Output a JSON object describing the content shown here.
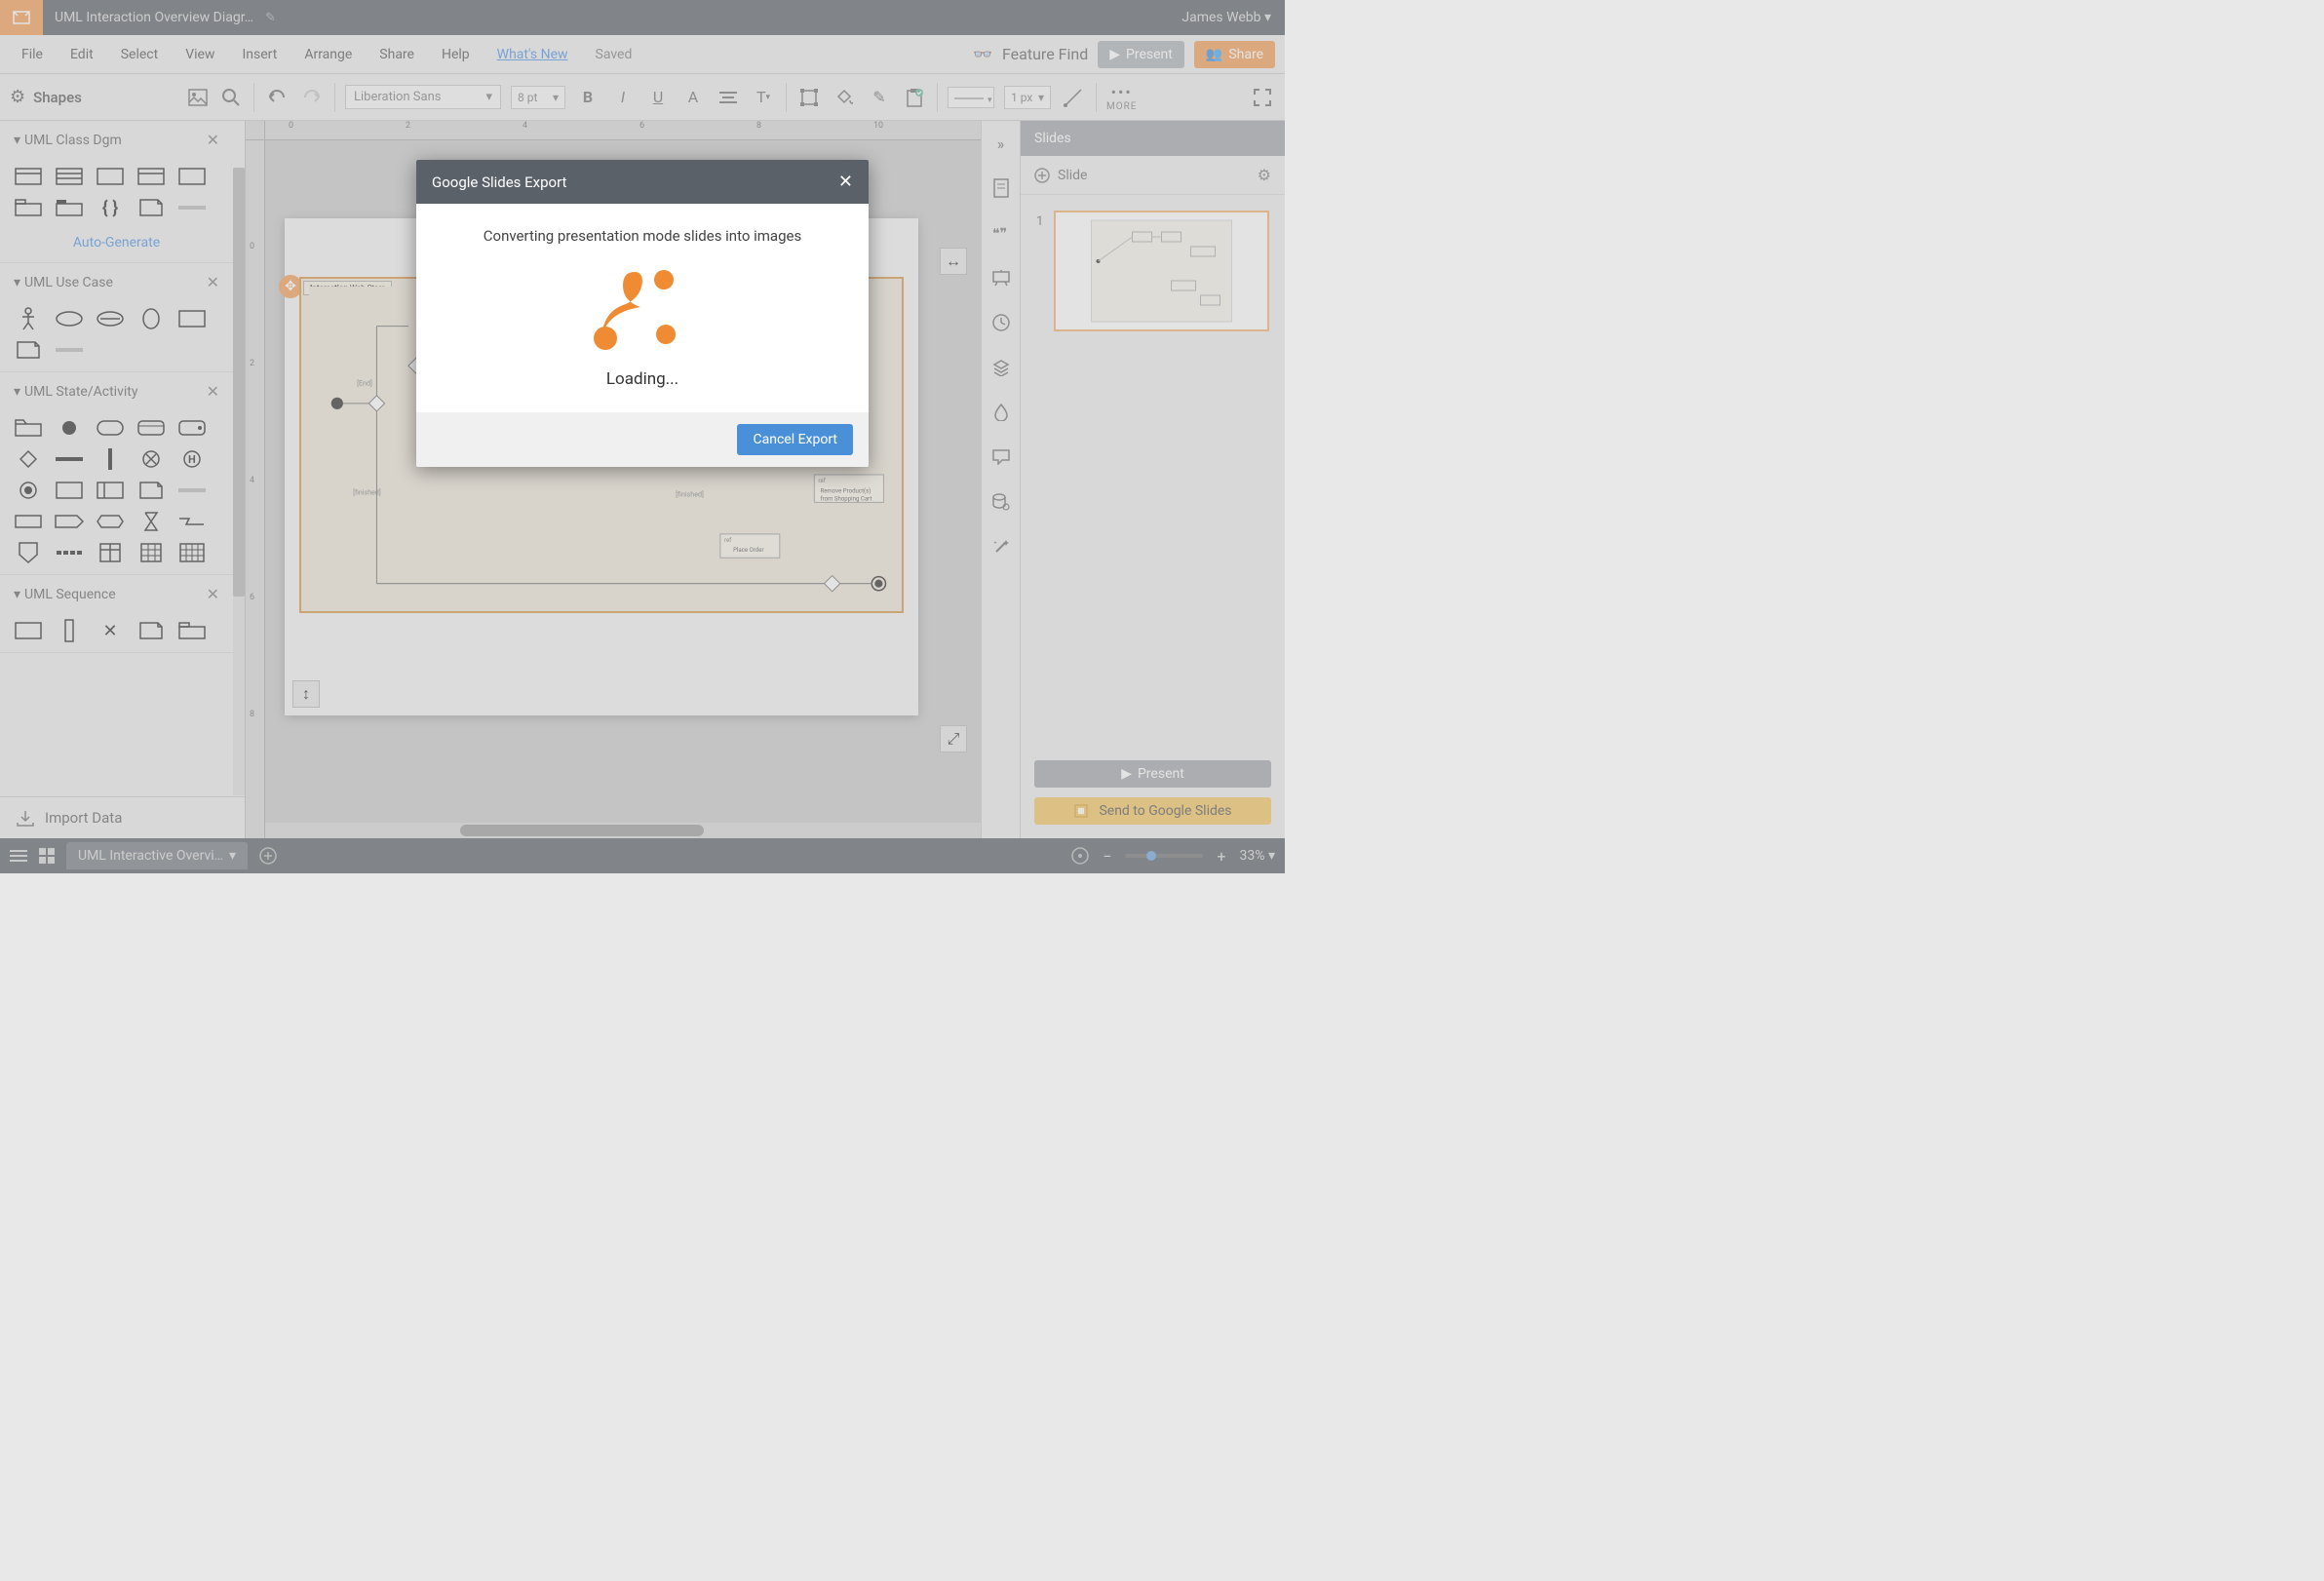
{
  "title_bar": {
    "doc_title": "UML Interaction Overview Diagr…",
    "user": "James Webb"
  },
  "menu": {
    "items": [
      "File",
      "Edit",
      "Select",
      "View",
      "Insert",
      "Arrange",
      "Share",
      "Help"
    ],
    "whats_new": "What's New",
    "saved": "Saved",
    "feature_find": "Feature Find",
    "present": "Present",
    "share": "Share"
  },
  "toolbar": {
    "shapes": "Shapes",
    "font": "Liberation Sans",
    "font_size": "8 pt",
    "line_width": "1 px",
    "more": "MORE"
  },
  "shape_groups": [
    {
      "name": "UML Class Dgm",
      "auto_gen": "Auto-Generate",
      "rows": 2
    },
    {
      "name": "UML Use Case",
      "rows": 2
    },
    {
      "name": "UML State/Activity",
      "rows": 5
    },
    {
      "name": "UML Sequence",
      "rows": 1
    }
  ],
  "import_data": "Import Data",
  "canvas": {
    "diagram_label": "Interaction Web Store",
    "labels": {
      "end": "[End]",
      "finished": "[finished]",
      "remove": "Remove Product(s) from Shopping Cart",
      "place_order": "Place Order",
      "ref": "ref"
    }
  },
  "slides_panel": {
    "title": "Slides",
    "add_slide": "Slide",
    "slide_num": "1",
    "present": "Present",
    "send_to_slides": "Send to Google Slides"
  },
  "bottom": {
    "tab": "UML Interactive Overvi…",
    "zoom": "33%"
  },
  "modal": {
    "title": "Google Slides Export",
    "message": "Converting presentation mode slides into images",
    "loading": "Loading...",
    "cancel": "Cancel Export"
  }
}
